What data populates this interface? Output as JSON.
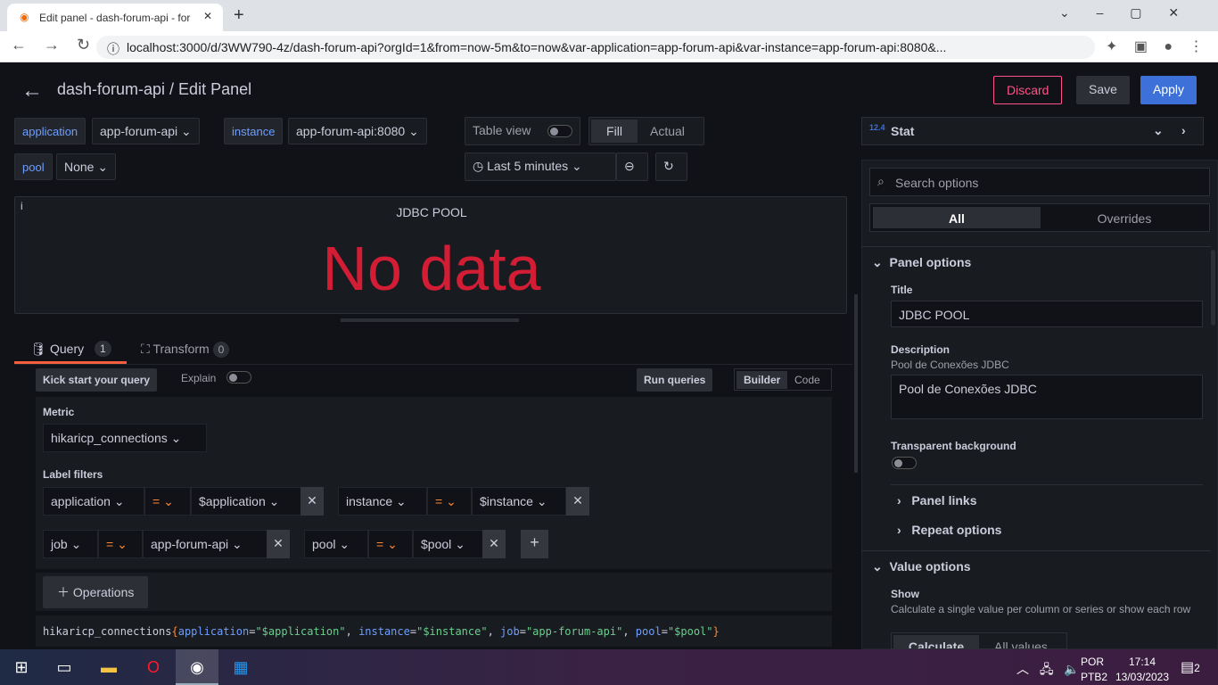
{
  "browser": {
    "tab_title": "Edit panel - dash-forum-api - for",
    "url": "localhost:3000/d/3WW790-4z/dash-forum-api?orgId=1&from=now-5m&to=now&var-application=app-forum-api&var-instance=app-forum-api:8080&..."
  },
  "header": {
    "title": "dash-forum-api / Edit Panel",
    "discard": "Discard",
    "save": "Save",
    "apply": "Apply"
  },
  "vars": [
    {
      "label": "application",
      "value": "app-forum-api"
    },
    {
      "label": "instance",
      "value": "app-forum-api:8080"
    },
    {
      "label": "pool",
      "value": "None"
    }
  ],
  "toolbar": {
    "table_view": "Table view",
    "fill": "Fill",
    "actual": "Actual",
    "time_range": "Last 5 minutes"
  },
  "panel": {
    "title": "JDBC POOL",
    "value": "No data",
    "info": "i"
  },
  "query_tabs": [
    {
      "label": "Query",
      "count": "1"
    },
    {
      "label": "Transform",
      "count": "0"
    }
  ],
  "query": {
    "kick_start": "Kick start your query",
    "explain": "Explain",
    "run": "Run queries",
    "builder": "Builder",
    "code": "Code",
    "metric_label": "Metric",
    "metric": "hikaricp_connections",
    "label_filters": "Label filters",
    "filters": [
      {
        "key": "application",
        "op": "=",
        "value": "$application"
      },
      {
        "key": "instance",
        "op": "=",
        "value": "$instance"
      },
      {
        "key": "job",
        "op": "=",
        "value": "app-forum-api"
      },
      {
        "key": "pool",
        "op": "=",
        "value": "$pool"
      }
    ],
    "operations": "Operations",
    "promql": {
      "metric": "hikaricp_connections",
      "parts": [
        [
          "application",
          "\"$application\""
        ],
        [
          "instance",
          "\"$instance\""
        ],
        [
          "job",
          "\"app-forum-api\""
        ],
        [
          "pool",
          "\"$pool\""
        ]
      ]
    }
  },
  "options": {
    "viz": "Stat",
    "search_placeholder": "Search options",
    "all": "All",
    "overrides": "Overrides",
    "panel_options": "Panel options",
    "title_label": "Title",
    "title_value": "JDBC POOL",
    "desc_label": "Description",
    "desc_hint": "Pool de Conexões JDBC",
    "desc_value": "Pool de Conexões JDBC",
    "transparent": "Transparent background",
    "panel_links": "Panel links",
    "repeat": "Repeat options",
    "value_options": "Value options",
    "show": "Show",
    "show_desc": "Calculate a single value per column or series or show each row",
    "calculate": "Calculate",
    "all_values": "All values"
  },
  "taskbar": {
    "lang1": "POR",
    "lang2": "PTB2",
    "time": "17:14",
    "date": "13/03/2023",
    "notifications": "2"
  },
  "colors": {
    "accent": "#3d71d9",
    "nodata": "#d21d35",
    "discard": "#ff5286"
  }
}
